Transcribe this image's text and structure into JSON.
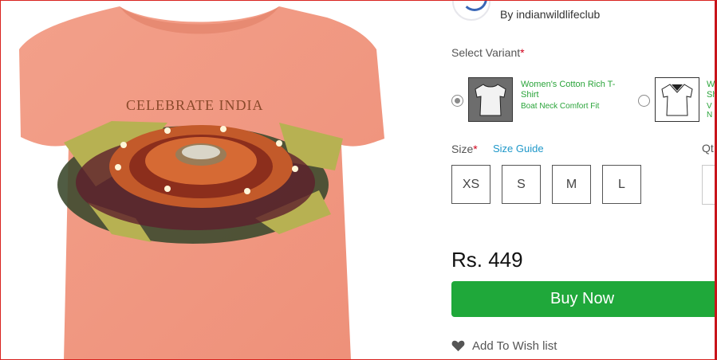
{
  "seller": {
    "by_text": "By indianwildlifeclub"
  },
  "product": {
    "print_text": "CELEBRATE INDIA",
    "image_icon": "tshirt-image"
  },
  "variant": {
    "label": "Select Variant",
    "required_mark": "*",
    "options": [
      {
        "name": "Women's Cotton Rich T-Shirt",
        "sub": "Boat Neck Comfort Fit",
        "selected": true,
        "icon": "tshirt-boat-neck-icon"
      },
      {
        "name": "W",
        "name2": "Sh",
        "sub": "V N",
        "selected": false,
        "icon": "tshirt-v-neck-icon"
      }
    ]
  },
  "size": {
    "label": "Size",
    "required_mark": "*",
    "guide_label": "Size Guide",
    "options": [
      "XS",
      "S",
      "M",
      "L"
    ]
  },
  "qty": {
    "label": "Qt"
  },
  "price": {
    "text": "Rs. 449"
  },
  "actions": {
    "buy_label": "Buy Now",
    "wishlist_label": "Add To Wish list"
  },
  "colors": {
    "accent_green": "#1fa83a",
    "link_blue": "#1f98c9",
    "shirt": "#f1977f"
  }
}
